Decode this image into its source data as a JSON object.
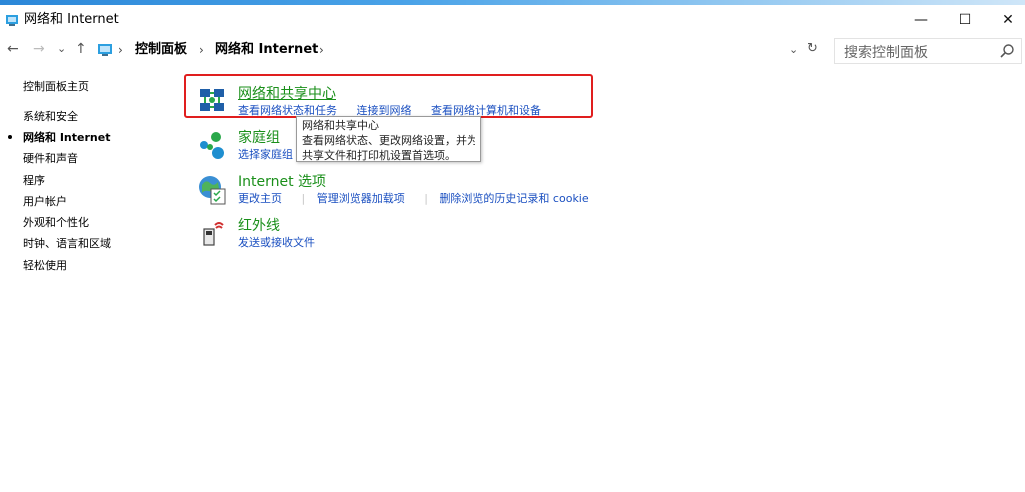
{
  "window": {
    "title": "网络和 Internet",
    "controls": {
      "minimize": "—",
      "maximize": "☐",
      "close": "✕"
    }
  },
  "nav": {
    "back": "←",
    "forward": "→",
    "recent": "⌄",
    "up": "↑",
    "dropdown": "⌄",
    "refresh": "↻"
  },
  "breadcrumb": {
    "items": [
      "控制面板",
      "网络和 Internet"
    ],
    "separator": "›"
  },
  "search": {
    "placeholder": "搜索控制面板"
  },
  "sidebar": {
    "items": [
      {
        "label": "控制面板主页",
        "active": false
      },
      {
        "label": "系统和安全",
        "active": false
      },
      {
        "label": "网络和 Internet",
        "active": true
      },
      {
        "label": "硬件和声音",
        "active": false
      },
      {
        "label": "程序",
        "active": false
      },
      {
        "label": "用户帐户",
        "active": false
      },
      {
        "label": "外观和个性化",
        "active": false
      },
      {
        "label": "时钟、语言和区域",
        "active": false
      },
      {
        "label": "轻松使用",
        "active": false
      }
    ]
  },
  "categories": [
    {
      "title": "网络和共享中心",
      "icon": "network-sharing-icon",
      "links": [
        "查看网络状态和任务",
        "连接到网络",
        "查看网络计算机和设备"
      ]
    },
    {
      "title": "家庭组",
      "icon": "homegroup-icon",
      "links": [
        "选择家庭组"
      ]
    },
    {
      "title": "Internet 选项",
      "icon": "internet-options-icon",
      "links": [
        "更改主页",
        "管理浏览器加载项",
        "删除浏览的历史记录和 cookie"
      ]
    },
    {
      "title": "红外线",
      "icon": "infrared-icon",
      "links": [
        "发送或接收文件"
      ]
    }
  ],
  "tooltip": {
    "lines": [
      "网络和共享中心",
      "查看网络状态、更改网络设置，并为",
      "共享文件和打印机设置首选项。"
    ]
  },
  "colors": {
    "category_title": "#1a8f1a",
    "link": "#1a4fc0",
    "highlight": "#e01e1e",
    "accent": "#2b87d8"
  }
}
